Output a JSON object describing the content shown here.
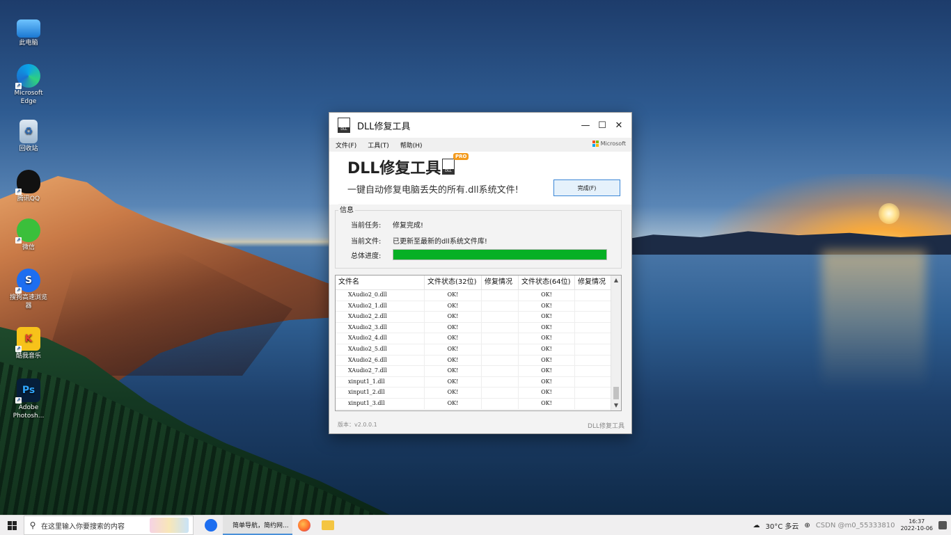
{
  "desktop": {
    "icons": [
      {
        "label": "此电脑",
        "icon": "computer-icon",
        "glyph": ""
      },
      {
        "label": "Microsoft Edge",
        "icon": "edge-icon",
        "glyph": ""
      },
      {
        "label": "回收站",
        "icon": "recycle-bin-icon",
        "glyph": "♻"
      },
      {
        "label": "腾讯QQ",
        "icon": "qq-icon",
        "glyph": ""
      },
      {
        "label": "微信",
        "icon": "wechat-icon",
        "glyph": ""
      },
      {
        "label": "搜狗高速浏览器",
        "icon": "sogou-browser-icon",
        "glyph": "S"
      },
      {
        "label": "酷我音乐",
        "icon": "kuwo-music-icon",
        "glyph": "K"
      },
      {
        "label": "Adobe Photosh...",
        "icon": "photoshop-icon",
        "glyph": "Ps"
      }
    ]
  },
  "window": {
    "title": "DLL修复工具",
    "controls": {
      "minimize": "—",
      "maximize": "☐",
      "close": "✕"
    },
    "menu": [
      "文件(F)",
      "工具(T)",
      "帮助(H)"
    ],
    "ms_brand": "Microsoft",
    "app_icon_text": "DLL",
    "brand_title": "DLL修复工具",
    "pro_badge": "PRO",
    "slogan": "一键自动修复电脑丢失的所有.dll系统文件!",
    "done_button": "完成(F)",
    "info": {
      "legend": "信息",
      "task_label": "当前任务:",
      "task_value": "修复完成!",
      "file_label": "当前文件:",
      "file_value": "已更新至最新的dll系统文件库!",
      "progress_label": "总体进度:",
      "progress": 100
    },
    "table": {
      "headers": [
        "文件名",
        "文件状态(32位)",
        "修复情况",
        "文件状态(64位)",
        "修复情况"
      ],
      "rows": [
        [
          "XAudio2_0.dll",
          "OK!",
          "",
          "OK!",
          ""
        ],
        [
          "XAudio2_1.dll",
          "OK!",
          "",
          "OK!",
          ""
        ],
        [
          "XAudio2_2.dll",
          "OK!",
          "",
          "OK!",
          ""
        ],
        [
          "XAudio2_3.dll",
          "OK!",
          "",
          "OK!",
          ""
        ],
        [
          "XAudio2_4.dll",
          "OK!",
          "",
          "OK!",
          ""
        ],
        [
          "XAudio2_5.dll",
          "OK!",
          "",
          "OK!",
          ""
        ],
        [
          "XAudio2_6.dll",
          "OK!",
          "",
          "OK!",
          ""
        ],
        [
          "XAudio2_7.dll",
          "OK!",
          "",
          "OK!",
          ""
        ],
        [
          "xinput1_1.dll",
          "OK!",
          "",
          "OK!",
          ""
        ],
        [
          "xinput1_2.dll",
          "OK!",
          "",
          "OK!",
          ""
        ],
        [
          "xinput1_3.dll",
          "OK!",
          "",
          "OK!",
          ""
        ]
      ]
    },
    "version": "版本：v2.0.0.1",
    "footer_brand": "DLL修复工具"
  },
  "taskbar": {
    "search_placeholder": "在这里输入你要搜索的内容",
    "app_label": "简单导航，简约网...",
    "weather": "30°C 多云",
    "watermark": "CSDN @m0_55333810",
    "time": "16:37",
    "date": "2022-10-06"
  },
  "colors": {
    "progress": "#06b025",
    "accent": "#3a86d6",
    "pro_badge": "#f39a1c"
  }
}
